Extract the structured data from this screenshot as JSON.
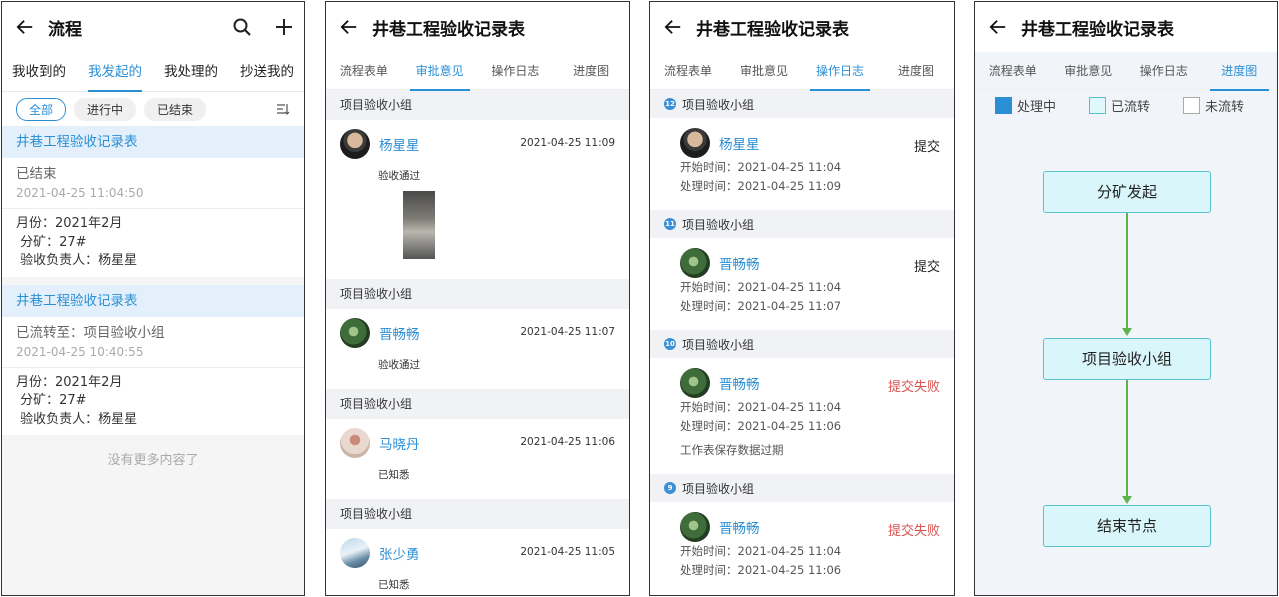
{
  "screen1": {
    "title": "流程",
    "tabs": [
      "我收到的",
      "我发起的",
      "我处理的",
      "抄送我的"
    ],
    "filters": [
      "全部",
      "进行中",
      "已结束"
    ],
    "cards": [
      {
        "title": "井巷工程验收记录表",
        "status": "已结束",
        "time": "2021-04-25 11:04:50",
        "lines": [
          "月份：2021年2月",
          " 分矿：27#",
          " 验收负责人：杨星星"
        ]
      },
      {
        "title": "井巷工程验收记录表",
        "status": "已流转至：项目验收小组",
        "time": "2021-04-25 10:40:55",
        "lines": [
          "月份：2021年2月",
          " 分矿：27#",
          " 验收负责人：杨星星"
        ]
      }
    ],
    "no_more": "没有更多内容了"
  },
  "detail_title": "井巷工程验收记录表",
  "detail_tabs": [
    "流程表单",
    "审批意见",
    "操作日志",
    "进度图"
  ],
  "screen2": {
    "opinions": [
      {
        "group": "项目验收小组",
        "name": "杨星星",
        "time": "2021-04-25 11:09",
        "note": "验收通过"
      },
      {
        "group": "项目验收小组",
        "name": "晋畅畅",
        "time": "2021-04-25 11:07",
        "note": "验收通过"
      },
      {
        "group": "项目验收小组",
        "name": "马晓丹",
        "time": "2021-04-25 11:06",
        "note": "已知悉"
      },
      {
        "group": "项目验收小组",
        "name": "张少勇",
        "time": "2021-04-25 11:05",
        "note": "已知悉"
      }
    ]
  },
  "screen3": {
    "logs": [
      {
        "num": "12",
        "group": "项目验收小组",
        "name": "杨星星",
        "status": "提交",
        "start": "开始时间：2021-04-25 11:04",
        "handle": "处理时间：2021-04-25 11:09",
        "extra": ""
      },
      {
        "num": "11",
        "group": "项目验收小组",
        "name": "晋畅畅",
        "status": "提交",
        "start": "开始时间：2021-04-25 11:04",
        "handle": "处理时间：2021-04-25 11:07",
        "extra": ""
      },
      {
        "num": "10",
        "group": "项目验收小组",
        "name": "晋畅畅",
        "status": "提交失败",
        "start": "开始时间：2021-04-25 11:04",
        "handle": "处理时间：2021-04-25 11:06",
        "extra": "工作表保存数据过期"
      },
      {
        "num": "9",
        "group": "项目验收小组",
        "name": "晋畅畅",
        "status": "提交失败",
        "start": "开始时间：2021-04-25 11:04",
        "handle": "处理时间：2021-04-25 11:06",
        "extra": ""
      }
    ]
  },
  "screen4": {
    "legend": [
      "处理中",
      "已流转",
      "未流转"
    ],
    "nodes": [
      "分矿发起",
      "项目验收小组",
      "结束节点"
    ],
    "colors": {
      "processing": "#2b8fd6",
      "done_fill": "#d9f6fa",
      "done_border": "#5bc3cf",
      "edge": "#5bb54a"
    }
  }
}
